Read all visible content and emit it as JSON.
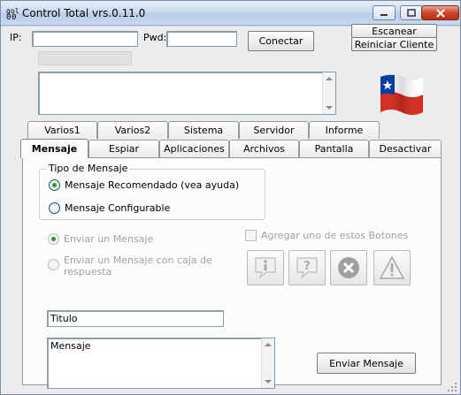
{
  "window": {
    "title": "Control Total vrs.0.11.0",
    "app_icon": "app-icon",
    "controls": [
      "minimize-icon",
      "maximize-icon",
      "close-icon"
    ]
  },
  "connection": {
    "ip_label": "IP:",
    "ip_value": "",
    "pwd_label": "Pwd:",
    "pwd_value": "",
    "connect_label": "Conectar",
    "scan_label": "Escanear",
    "restart_label": "Reiniciar Cliente"
  },
  "log": {
    "value": ""
  },
  "flag": {
    "icon": "chile-flag-icon"
  },
  "tabs_row1": [
    {
      "label": "Varios1"
    },
    {
      "label": "Varios2"
    },
    {
      "label": "Sistema"
    },
    {
      "label": "Servidor"
    },
    {
      "label": "Informe"
    }
  ],
  "tabs_row2": [
    {
      "label": "Mensaje",
      "active": true
    },
    {
      "label": "Espiar"
    },
    {
      "label": "Aplicaciones"
    },
    {
      "label": "Archivos"
    },
    {
      "label": "Pantalla"
    },
    {
      "label": "Desactivar"
    }
  ],
  "message": {
    "type_group_title": "Tipo de Mensaje",
    "recommended_label": "Mensaje Recomendado (vea ayuda)",
    "configurable_label": "Mensaje Configurable",
    "send_message_radio": "Enviar un Mensaje",
    "send_with_reply_radio": "Enviar un Mensaje con caja de respuesta",
    "add_buttons_label": "Agregar uno de estos Botones",
    "title_value": "Titulo",
    "body_value": "Mensaje",
    "send_button_label": "Enviar Mensaje",
    "button_icons": [
      "info-icon",
      "question-icon",
      "error-icon",
      "warning-icon"
    ]
  },
  "colors": {
    "accent_green": "#21a121",
    "flag_red": "#d52b1e",
    "flag_blue": "#0039a6"
  }
}
